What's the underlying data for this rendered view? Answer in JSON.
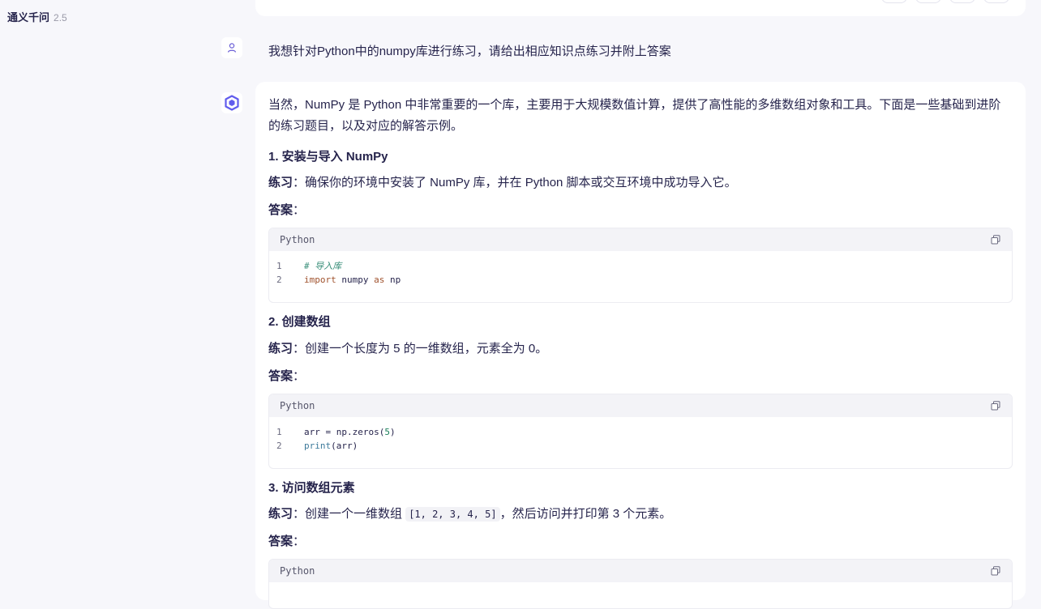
{
  "brand": {
    "name": "通义千问",
    "version": "2.5"
  },
  "user": {
    "message": "我想针对Python中的numpy库进行练习，请给出相应知识点练习并附上答案"
  },
  "assistant": {
    "intro": "当然，NumPy 是 Python 中非常重要的一个库，主要用于大规模数值计算，提供了高性能的多维数组对象和工具。下面是一些基础到进阶的练习题目，以及对应的解答示例。",
    "sections": [
      {
        "heading": "1. 安装与导入 NumPy",
        "exercise_label": "练习",
        "exercise_text": "：确保你的环境中安装了 NumPy 库，并在 Python 脚本或交互环境中成功导入它。",
        "answer_label": "答案",
        "answer_colon": "：",
        "code_lang": "Python",
        "code_lines": [
          "# 导入库",
          "import numpy as np"
        ]
      },
      {
        "heading": "2. 创建数组",
        "exercise_label": "练习",
        "exercise_text": "：创建一个长度为 5 的一维数组，元素全为 0。",
        "answer_label": "答案",
        "answer_colon": "：",
        "code_lang": "Python",
        "code_lines": [
          "arr = np.zeros(5)",
          "print(arr)"
        ]
      },
      {
        "heading": "3. 访问数组元素",
        "exercise_label": "练习",
        "exercise_pre": "：创建一个一维数组 ",
        "exercise_code": "[1, 2, 3, 4, 5]",
        "exercise_post": "，然后访问并打印第 3 个元素。",
        "answer_label": "答案",
        "answer_colon": "：",
        "code_lang": "Python"
      }
    ]
  }
}
